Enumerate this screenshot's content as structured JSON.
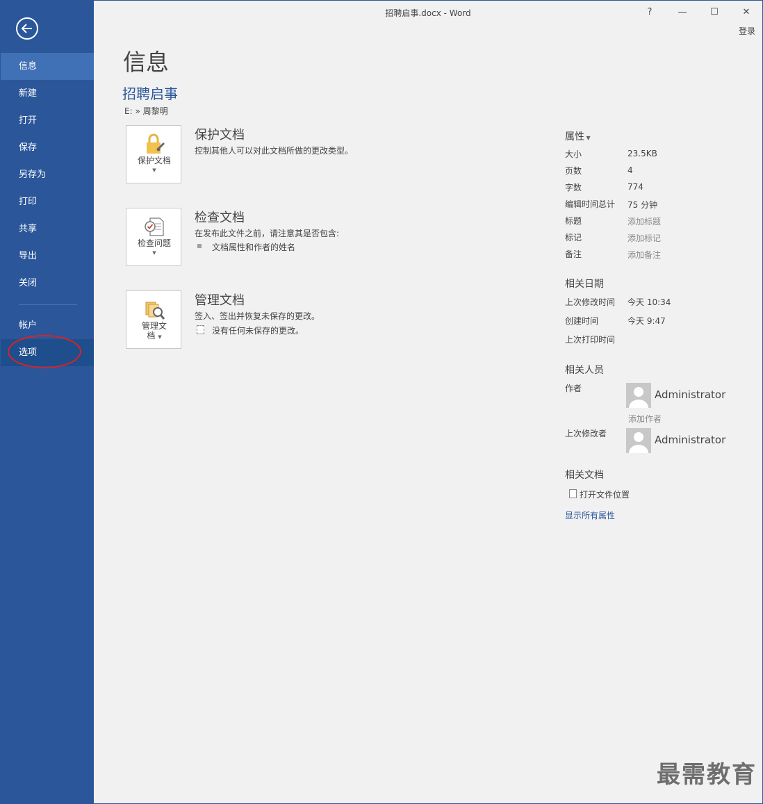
{
  "window": {
    "title": "招聘启事.docx - Word",
    "help": "?",
    "minimize": "—",
    "maximize": "☐",
    "close": "✕",
    "login": "登录"
  },
  "sidebar": {
    "items": [
      {
        "label": "信息"
      },
      {
        "label": "新建"
      },
      {
        "label": "打开"
      },
      {
        "label": "保存"
      },
      {
        "label": "另存为"
      },
      {
        "label": "打印"
      },
      {
        "label": "共享"
      },
      {
        "label": "导出"
      },
      {
        "label": "关闭"
      },
      {
        "label": "帐户"
      },
      {
        "label": "选项"
      }
    ]
  },
  "main": {
    "page_title": "信息",
    "doc_title": "招聘启事",
    "path": "E: » 周黎明",
    "sections": [
      {
        "tile_label": "保护文档",
        "title": "保护文档",
        "desc": "控制其他人可以对此文档所做的更改类型。"
      },
      {
        "tile_label": "检查问题",
        "title": "检查文档",
        "desc": "在发布此文件之前，请注意其是否包含:",
        "bullet": "文档属性和作者的姓名"
      },
      {
        "tile_label_1": "管理文",
        "tile_label_2": "档",
        "title": "管理文档",
        "desc": "签入、签出并恢复未保存的更改。",
        "bullet": "没有任何未保存的更改。"
      }
    ]
  },
  "properties": {
    "head": "属性",
    "rows": [
      {
        "label": "大小",
        "value": "23.5KB"
      },
      {
        "label": "页数",
        "value": "4"
      },
      {
        "label": "字数",
        "value": "774"
      },
      {
        "label": "编辑时间总计",
        "value": "75 分钟"
      },
      {
        "label": "标题",
        "value": "添加标题"
      },
      {
        "label": "标记",
        "value": "添加标记"
      },
      {
        "label": "备注",
        "value": "添加备注"
      }
    ],
    "dates_head": "相关日期",
    "dates": [
      {
        "label": "上次修改时间",
        "value": "今天 10:34"
      },
      {
        "label": "创建时间",
        "value": "今天 9:47"
      },
      {
        "label": "上次打印时间",
        "value": ""
      }
    ],
    "people_head": "相关人员",
    "author_label": "作者",
    "author_name": "Administrator",
    "add_author": "添加作者",
    "last_modified_by_label": "上次修改者",
    "last_modified_by_name": "Administrator",
    "related_docs_head": "相关文档",
    "open_location": "打开文件位置",
    "show_all": "显示所有属性"
  },
  "watermark": "最需教育"
}
